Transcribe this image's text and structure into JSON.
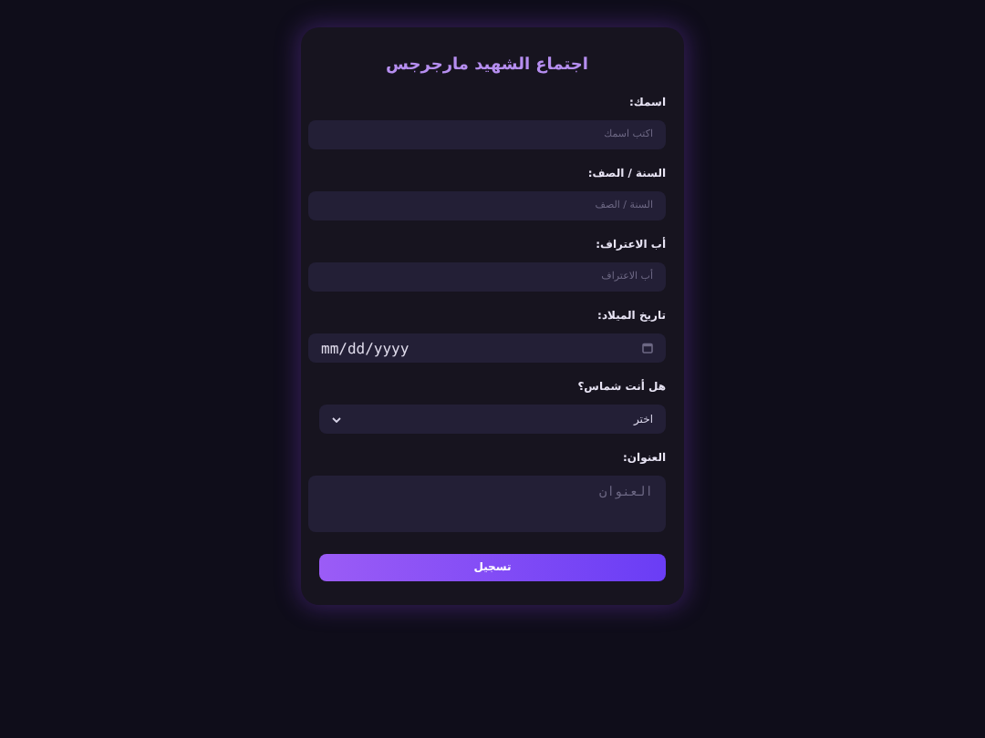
{
  "title": "اجتماع الشهيد مارجرجس",
  "fields": [
    {
      "kind": "text",
      "label": "اسمك:",
      "placeholder": "اكتب اسمك"
    },
    {
      "kind": "text",
      "label": "السنة / الصف:",
      "placeholder": "السنة / الصف"
    },
    {
      "kind": "text",
      "label": "أب الاعتراف:",
      "placeholder": "أب الاعتراف"
    },
    {
      "kind": "date",
      "label": "تاريخ الميلاد:",
      "value": "mm/dd/yyyy"
    },
    {
      "kind": "select",
      "label": "هل أنت شماس؟",
      "value": "اختر"
    },
    {
      "kind": "textarea",
      "label": "العنوان:",
      "placeholder": "العنوان"
    }
  ],
  "submit": "تسجيل"
}
